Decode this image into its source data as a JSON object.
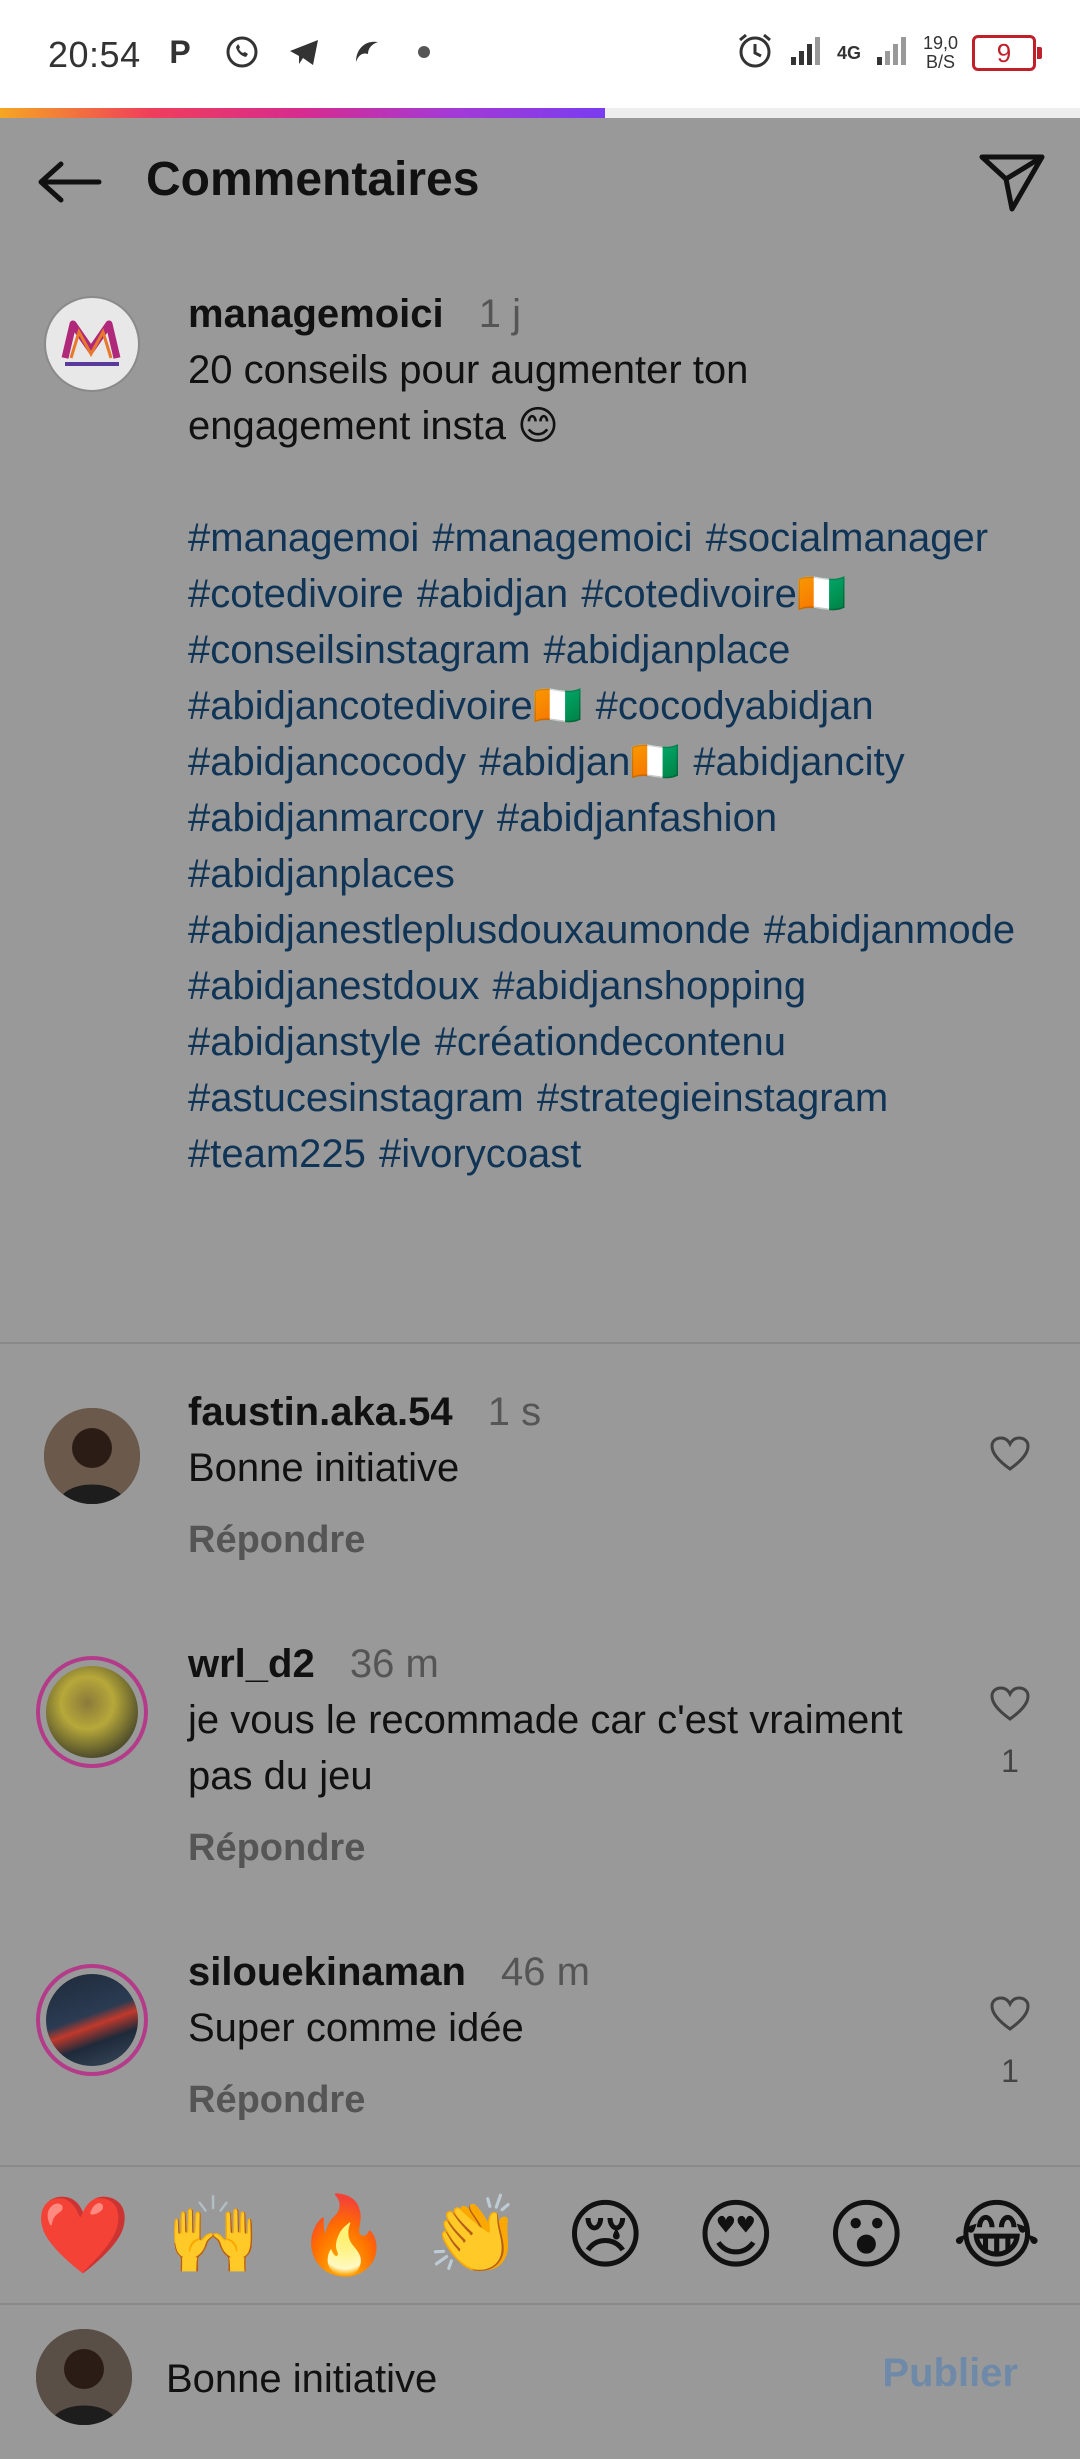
{
  "status_bar": {
    "time": "20:54",
    "network": "4G",
    "speed_value": "19,0",
    "speed_unit": "B/S",
    "battery": "9",
    "left_icons": [
      "parking-icon",
      "whatsapp-icon",
      "telegram-icon",
      "app-icon"
    ],
    "right_icons": [
      "alarm-icon",
      "signal-icon",
      "signal-icon-2"
    ]
  },
  "progress": {
    "fill_fraction": 0.56,
    "colors": [
      "#f5a623",
      "#ef3e5b",
      "#d62b8f",
      "#a33ad6",
      "#7a3cf0"
    ]
  },
  "header": {
    "title": "Commentaires"
  },
  "caption": {
    "username": "managemoici",
    "time": "1 j",
    "text_line1": "20 conseils pour augmenter ton",
    "text_line2": "engagement insta 😊",
    "hashtags": [
      "#managemoi",
      "#managemoici",
      "#socialmanager",
      "#cotedivoire",
      "#abidjan",
      "#cotedivoire🇨🇮",
      "#conseilsinstagram",
      "#abidjanplace",
      "#abidjancotedivoire🇨🇮",
      "#cocodyabidjan",
      "#abidjancocody",
      "#abidjan🇨🇮",
      "#abidjancity",
      "#abidjanmarcory",
      "#abidjanfashion",
      "#abidjanplaces",
      "#abidjanestleplusdouxaumonde",
      "#abidjanmode",
      "#abidjanestdoux",
      "#abidjanshopping",
      "#abidjanstyle",
      "#créationdecontenu",
      "#astucesinstagram",
      "#strategieinstagram",
      "#team225",
      "#ivorycoast"
    ]
  },
  "comments": [
    {
      "username": "faustin.aka.54",
      "time": "1 s",
      "line1": "Bonne initiative",
      "line2": "",
      "reply": "Répondre",
      "likes": ""
    },
    {
      "username": "wrl_d2",
      "time": "36 m",
      "line1": "je vous le recommade car c'est vraiment",
      "line2": "pas du jeu",
      "reply": "Répondre",
      "likes": "1"
    },
    {
      "username": "silouekinaman",
      "time": "46 m",
      "line1": "Super comme idée",
      "line2": "",
      "reply": "Répondre",
      "likes": "1"
    }
  ],
  "emojis": [
    "❤️",
    "🙌",
    "🔥",
    "👏",
    "😢",
    "😍",
    "😮",
    "😂"
  ],
  "input": {
    "value": "Bonne initiative",
    "publish_label": "Publier"
  },
  "colors": {
    "overlay": "#999999",
    "hashtag": "#0f3456",
    "ring": "#b43b8a",
    "publish": "#6f8aa8"
  }
}
